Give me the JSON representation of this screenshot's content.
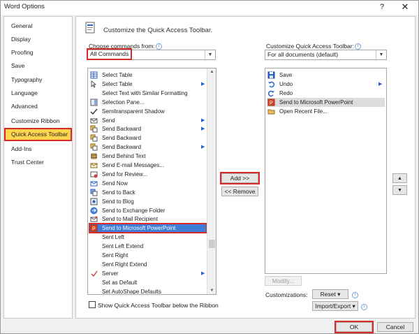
{
  "window": {
    "title": "Word Options",
    "help": "?",
    "close": "✕"
  },
  "sidebar": {
    "items": [
      {
        "label": "General"
      },
      {
        "label": "Display"
      },
      {
        "label": "Proofing"
      },
      {
        "label": "Save"
      },
      {
        "label": "Typography"
      },
      {
        "label": "Language"
      },
      {
        "label": "Advanced"
      },
      {
        "label": "Customize Ribbon"
      },
      {
        "label": "Quick Access Toolbar"
      },
      {
        "label": "Add-Ins"
      },
      {
        "label": "Trust Center"
      }
    ],
    "active_index": 8
  },
  "main": {
    "header": "Customize the Quick Access Toolbar.",
    "choose_label": "Choose commands from:",
    "choose_value": "All Commands",
    "customize_label": "Customize Quick Access Toolbar:",
    "customize_value": "For all documents (default)",
    "commands": [
      {
        "label": "Select Table",
        "icon": "table-icon",
        "sub": false
      },
      {
        "label": "Select Table",
        "icon": "cursor-icon",
        "sub": true
      },
      {
        "label": "Select Text with Similar Formatting",
        "icon": "",
        "sub": false
      },
      {
        "label": "Selection Pane...",
        "icon": "selection-pane-icon",
        "sub": false
      },
      {
        "label": "Semitransparent Shadow",
        "icon": "check-icon",
        "sub": false
      },
      {
        "label": "Send",
        "icon": "send-icon",
        "sub": true
      },
      {
        "label": "Send Backward",
        "icon": "send-backward-icon",
        "sub": true
      },
      {
        "label": "Send Backward",
        "icon": "send-backward-icon",
        "sub": false
      },
      {
        "label": "Send Backward",
        "icon": "send-backward-icon",
        "sub": true
      },
      {
        "label": "Send Behind Text",
        "icon": "behind-text-icon",
        "sub": false
      },
      {
        "label": "Send E-mail Messages...",
        "icon": "email-icon",
        "sub": false
      },
      {
        "label": "Send for Review...",
        "icon": "review-icon",
        "sub": false
      },
      {
        "label": "Send Now",
        "icon": "send-now-icon",
        "sub": false
      },
      {
        "label": "Send to Back",
        "icon": "send-to-back-icon",
        "sub": false
      },
      {
        "label": "Send to Blog",
        "icon": "blog-icon",
        "sub": false
      },
      {
        "label": "Send to Exchange Folder",
        "icon": "exchange-icon",
        "sub": false
      },
      {
        "label": "Send to Mail Recipient",
        "icon": "mail-recipient-icon",
        "sub": false
      },
      {
        "label": "Send to Microsoft PowerPoint",
        "icon": "powerpoint-icon",
        "sub": false
      },
      {
        "label": "Sent Left",
        "icon": "",
        "sub": false
      },
      {
        "label": "Sent Left Extend",
        "icon": "",
        "sub": false
      },
      {
        "label": "Sent Right",
        "icon": "",
        "sub": false
      },
      {
        "label": "Sent Right Extend",
        "icon": "",
        "sub": false
      },
      {
        "label": "Server",
        "icon": "server-icon",
        "sub": true
      },
      {
        "label": "Set as Default",
        "icon": "",
        "sub": false
      },
      {
        "label": "Set AutoShape Defaults",
        "icon": "",
        "sub": false
      }
    ],
    "selected_command_index": 17,
    "toolbar_items": [
      {
        "label": "Save",
        "icon": "save-icon",
        "sub": false
      },
      {
        "label": "Undo",
        "icon": "undo-icon",
        "sub": true
      },
      {
        "label": "Redo",
        "icon": "redo-icon",
        "sub": false
      },
      {
        "label": "Send to Microsoft PowerPoint",
        "icon": "powerpoint-icon",
        "sub": false
      },
      {
        "label": "Open Recent File...",
        "icon": "open-recent-icon",
        "sub": false
      }
    ],
    "selected_toolbar_index": 3,
    "add_button": "Add >>",
    "remove_button": "<< Remove",
    "modify_button": "Modify...",
    "customizations_label": "Customizations:",
    "reset_button": "Reset ▾",
    "import_export_button": "Import/Export ▾",
    "show_below_label": "Show Quick Access Toolbar below the Ribbon"
  },
  "footer": {
    "ok": "OK",
    "cancel": "Cancel"
  },
  "colors": {
    "accent_highlight": "#ffd54e",
    "selection_blue": "#3e7ed8",
    "annotation_red": "#d92a2a"
  }
}
